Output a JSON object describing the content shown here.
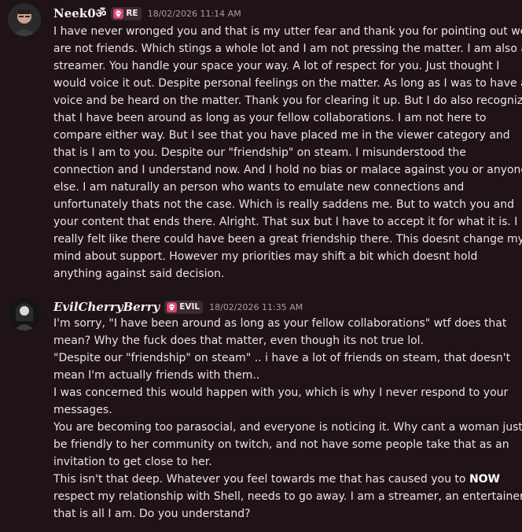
{
  "messages": [
    {
      "author": "Neek0ॐ",
      "tag": "RE",
      "timestamp": "18/02/2026 11:14 AM",
      "lines": [
        "I have never wronged you and that is my utter fear and thank you for pointing out we",
        "are not friends. Which stings a whole lot and I am not pressing the matter. I am also a",
        "streamer. You handle your space your way. A lot of respect for you. Just thought I",
        "would voice it out. Despite personal feelings on the matter. As long as I was to have a",
        "voice and be heard on the matter. Thank you for clearing it up. But I do also recognize",
        "that I have been around as long as your fellow collaborations. I am not here to",
        "compare either way. But I see that you have placed me in the viewer category and",
        "that is I am to you. Despite our \"friendship\" on steam. I misunderstood the",
        "connection and I understand now. And I hold no bias or malace against you or anyone",
        "else. I am naturally an person who wants to emulate new connections and",
        "unfortunately thats not the case. Which is really saddens me. But to watch you and",
        "your content that ends there. Alright. That sux but I have to accept it for what it is. I",
        "really felt like there could have been a great friendship there. This doesnt change my",
        "mind about support. However my priorities may shift a bit which doesnt hold",
        "anything against said decision."
      ]
    },
    {
      "author": "EvilCherryBerry",
      "tag": "EVIL",
      "timestamp": "18/02/2026 11:35 AM",
      "lines": [
        "I'm sorry, \"I have been around as long as your fellow collaborations\" wtf does that",
        "mean? Why the fuck does that matter, even though its not true lol.",
        "\"Despite our \"friendship\" on steam\" .. i have a lot of friends on steam, that doesn't",
        "mean I'm actually friends with them..",
        "I was concerned this would happen with you, which is why I never respond to your",
        "messages.",
        "You are becoming too parasocial, and everyone is noticing it. Why cant a woman just",
        "be friendly to her community on twitch, and not have some people take that as an",
        "invitation to get close to her.",
        "This isn't that deep. Whatever you feel towards me that has caused you to ",
        "NOW",
        "respect my relationship with Shell, needs to go away. I am a streamer, an entertainer,",
        "that is all I am. Do you understand?"
      ]
    }
  ]
}
